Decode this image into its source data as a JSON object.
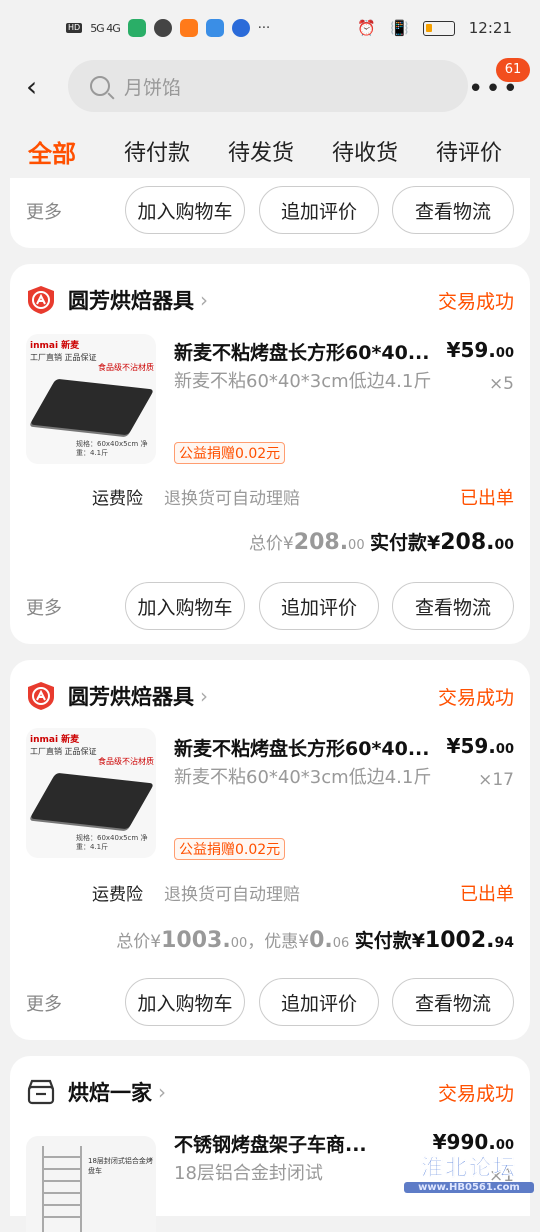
{
  "status_bar": {
    "time": "12:21",
    "network": "5G 4G"
  },
  "header": {
    "search_placeholder": "月饼馅",
    "badge_count": "61"
  },
  "tabs": [
    "全部",
    "待付款",
    "待发货",
    "待收货",
    "待评价"
  ],
  "card_top": {
    "more": "更多",
    "buttons": [
      "加入购物车",
      "追加评价",
      "查看物流"
    ]
  },
  "order1": {
    "shop": "圆芳烘焙器具",
    "status": "交易成功",
    "thumb_brand": "inmai 新麦",
    "thumb_tag1": "工厂直销 正品保证",
    "thumb_tag2": "食品级不沾材质",
    "thumb_spec": "规格：60x40x5cm 净重：4.1斤",
    "title": "新麦不粘烤盘长方形60*40...",
    "price_int": "¥59.",
    "price_dec": "00",
    "spec": "新麦不粘60*40*3cm低边4.1斤",
    "qty": "×5",
    "charity": "公益捐赠0.02元",
    "svc1": "运费险",
    "svc2": "退换货可自动理赔",
    "ship_status": "已出单",
    "total_label": "总价¥",
    "total_int": "208.",
    "total_dec": "00",
    "pay_label": "实付款¥",
    "pay_int": "208.",
    "pay_dec": "00",
    "more": "更多",
    "buttons": [
      "加入购物车",
      "追加评价",
      "查看物流"
    ]
  },
  "order2": {
    "shop": "圆芳烘焙器具",
    "status": "交易成功",
    "thumb_brand": "inmai 新麦",
    "thumb_tag1": "工厂直销 正品保证",
    "thumb_tag2": "食品级不沾材质",
    "thumb_spec": "规格：60x40x5cm 净重：4.1斤",
    "title": "新麦不粘烤盘长方形60*40...",
    "price_int": "¥59.",
    "price_dec": "00",
    "spec": "新麦不粘60*40*3cm低边4.1斤",
    "qty": "×17",
    "charity": "公益捐赠0.02元",
    "svc1": "运费险",
    "svc2": "退换货可自动理赔",
    "ship_status": "已出单",
    "total_label": "总价¥",
    "total_int": "1003.",
    "total_dec": "00",
    "discount_label": "，优惠¥",
    "discount_int": "0.",
    "discount_dec": "06",
    "pay_label": "实付款¥",
    "pay_int": "1002.",
    "pay_dec": "94",
    "more": "更多",
    "buttons": [
      "加入购物车",
      "追加评价",
      "查看物流"
    ]
  },
  "order3": {
    "shop": "烘焙一家",
    "status": "交易成功",
    "thumb_txt": "18层封闭式铝合金烤盘车",
    "title": "不锈钢烤盘架子车商...",
    "price_int": "¥990.",
    "price_dec": "00",
    "spec": "18层铝合金封闭试",
    "qty": "×1"
  },
  "watermark": {
    "line1": "淮北论坛",
    "line2": "www.HB0561.com"
  }
}
